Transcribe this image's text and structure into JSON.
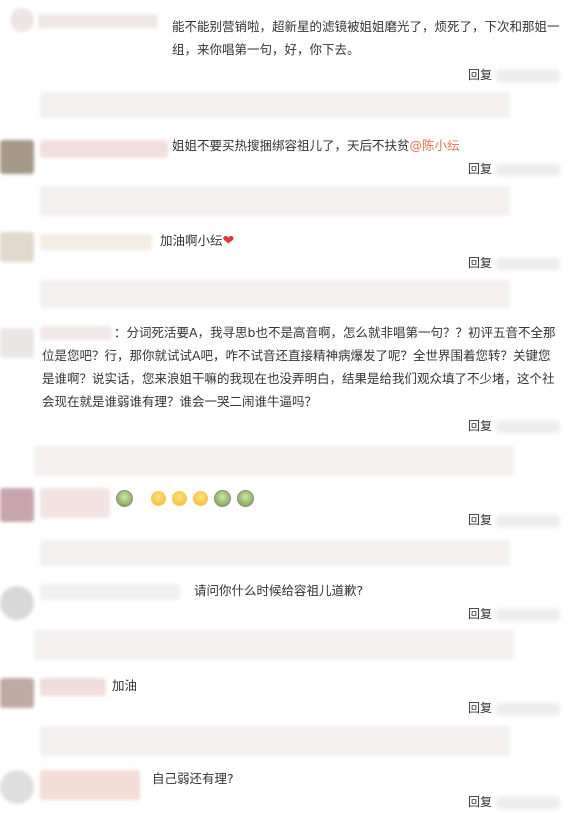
{
  "reply_label": "回复",
  "comments": [
    {
      "text": "能不能别营销啦，超新星的滤镜被姐姐磨光了，烦死了，下次和那姐一组，来你唱第一句，好，你下去。"
    },
    {
      "text": "姐姐不要买热搜捆绑容祖儿了，天后不扶贫",
      "mention": "@陈小纭"
    },
    {
      "text": "加油啊小纭",
      "heart": "❤"
    },
    {
      "text": "：分词死活要A，我寻思b也不是高音啊，怎么就非唱第一句？？初评五音不全那位是您吧？行，那你就试试A吧，咋不试音还直接精神病爆发了呢？全世界围着您转？关键您是谁啊？说实话，您来浪姐干嘛的我现在也没弄明白，结果是给我们观众填了不少堵，这个社会现在就是谁弱谁有理？谁会一哭二闹谁牛逼吗？"
    },
    {
      "emoji_seq": [
        "bowl-icon",
        "laugh-icon",
        "laugh-icon",
        "laugh-icon",
        "bowl-icon",
        "bowl-icon"
      ]
    },
    {
      "text": "请问你什么时候给容祖儿道歉?"
    },
    {
      "text": "加油"
    },
    {
      "text": "自己弱还有理?"
    }
  ]
}
